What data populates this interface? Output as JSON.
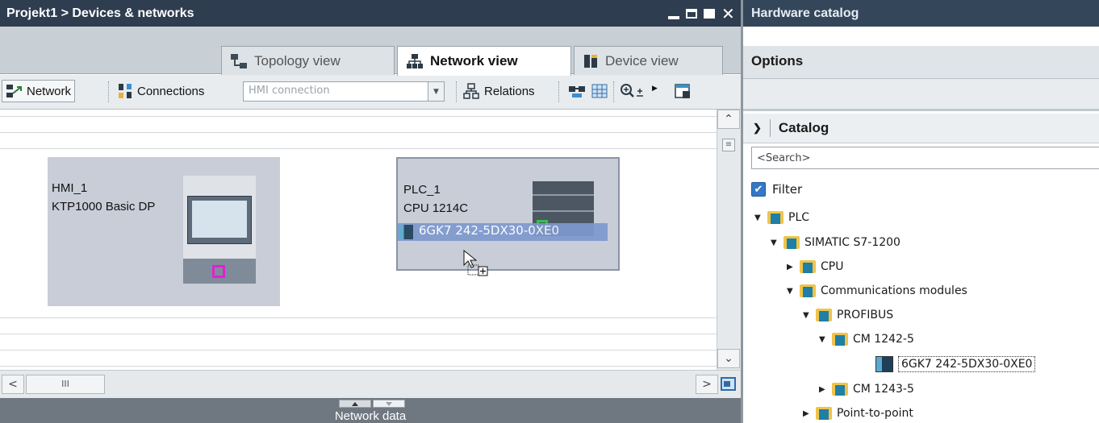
{
  "left_title": "Projekt1 > Devices & networks",
  "right_title": "Hardware catalog",
  "view_tabs": [
    {
      "label": "Topology view"
    },
    {
      "label": "Network view"
    },
    {
      "label": "Device view"
    }
  ],
  "toolbar": {
    "network_label": "Network",
    "connections_label": "Connections",
    "connection_type": "HMI connection",
    "relations_label": "Relations"
  },
  "devices": {
    "hmi": {
      "name": "HMI_1",
      "type": "KTP1000 Basic DP"
    },
    "plc": {
      "name": "PLC_1",
      "type": "CPU 1214C",
      "drag_item": "6GK7 242-5DX30-0XE0"
    }
  },
  "scroll": {
    "h_thumb_symbol": "III"
  },
  "bottom_bar": {
    "label": "Network data"
  },
  "options_label": "Options",
  "catalog": {
    "header": "Catalog",
    "search_placeholder": "<Search>",
    "filter_label": "Filter",
    "tree": [
      {
        "label": "PLC"
      },
      {
        "label": "SIMATIC S7-1200"
      },
      {
        "label": "CPU"
      },
      {
        "label": "Communications modules"
      },
      {
        "label": "PROFIBUS"
      },
      {
        "label": "CM 1242-5"
      },
      {
        "label": "6GK7 242-5DX30-0XE0"
      },
      {
        "label": "CM 1243-5"
      },
      {
        "label": "Point-to-point"
      }
    ]
  }
}
